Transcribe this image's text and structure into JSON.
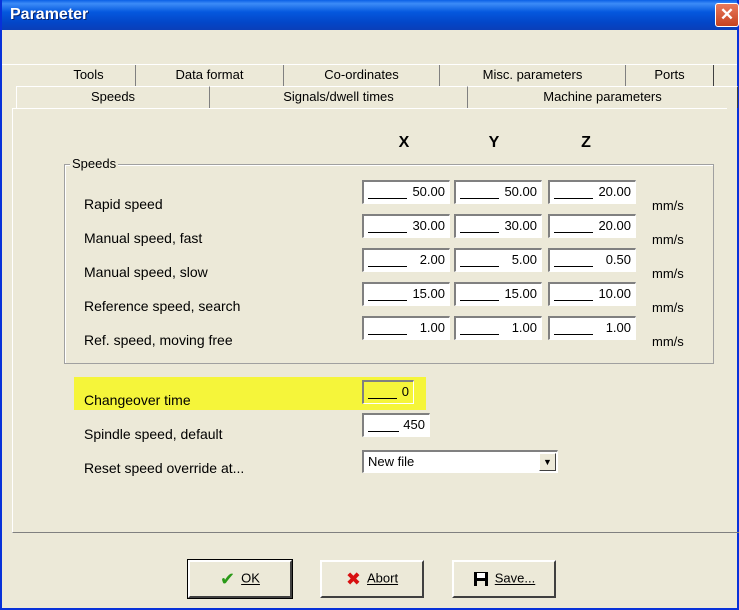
{
  "window": {
    "title": "Parameter",
    "close_glyph": "✕"
  },
  "tabs": {
    "back_row": [
      {
        "label": "Tools"
      },
      {
        "label": "Data format"
      },
      {
        "label": "Co-ordinates"
      },
      {
        "label": "Misc. parameters"
      },
      {
        "label": "Ports"
      }
    ],
    "front_row": [
      {
        "label": "Speeds",
        "selected": true
      },
      {
        "label": "Signals/dwell times"
      },
      {
        "label": "Machine parameters"
      }
    ]
  },
  "columns": {
    "x": "X",
    "y": "Y",
    "z": "Z"
  },
  "speeds_group": {
    "label": "Speeds",
    "rows": [
      {
        "label": "Rapid speed",
        "x": "50.00",
        "y": "50.00",
        "z": "20.00",
        "unit": "mm/s"
      },
      {
        "label": "Manual speed, fast",
        "x": "30.00",
        "y": "30.00",
        "z": "20.00",
        "unit": "mm/s"
      },
      {
        "label": "Manual speed, slow",
        "x": "2.00",
        "y": "5.00",
        "z": "0.50",
        "unit": "mm/s"
      },
      {
        "label": "Reference speed, search",
        "x": "15.00",
        "y": "15.00",
        "z": "10.00",
        "unit": "mm/s"
      },
      {
        "label": "Ref. speed, moving free",
        "x": "1.00",
        "y": "1.00",
        "z": "1.00",
        "unit": "mm/s"
      }
    ]
  },
  "changeover": {
    "label": "Changeover time",
    "value": "0",
    "highlight_color": "#f5f53a"
  },
  "spindle": {
    "label": "Spindle speed, default",
    "value": "450"
  },
  "reset_override": {
    "label": "Reset speed override at...",
    "selected": "New file"
  },
  "buttons": {
    "ok": {
      "label": "OK",
      "icon": "checkmark-icon"
    },
    "abort": {
      "label": "Abort",
      "icon": "x-icon"
    },
    "save": {
      "label": "Save...",
      "icon": "floppy-icon"
    }
  }
}
